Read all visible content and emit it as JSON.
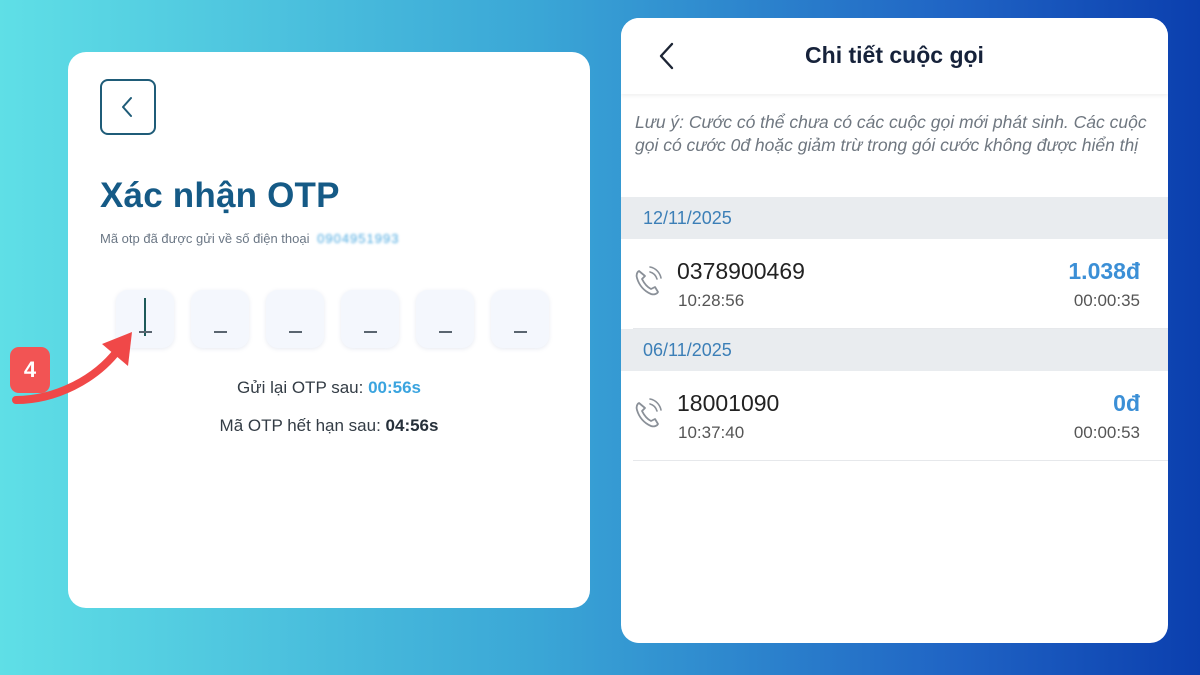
{
  "otp": {
    "title": "Xác nhận OTP",
    "subtitle": "Mã otp đã được gửi về số điện thoại",
    "phone_masked": "0904951993",
    "boxes": [
      "",
      "",
      "",
      "",
      "",
      ""
    ],
    "resend_label": "Gửi lại OTP sau: ",
    "resend_timer": "00:56s",
    "expire_label": "Mã OTP hết hạn sau: ",
    "expire_timer": "04:56s",
    "step_badge": "4"
  },
  "call_detail": {
    "title": "Chi tiết cuộc gọi",
    "note": "Lưu ý: Cước có thể chưa có các cuộc gọi mới phát sinh. Các cuộc gọi có cước 0đ hoặc giảm trừ trong gói cước không được hiển thị",
    "groups": [
      {
        "date": "12/11/2025",
        "calls": [
          {
            "number": "0378900469",
            "time": "10:28:56",
            "cost": "1.038đ",
            "duration": "00:00:35"
          }
        ]
      },
      {
        "date": "06/11/2025",
        "calls": [
          {
            "number": "18001090",
            "time": "10:37:40",
            "cost": "0đ",
            "duration": "00:00:53"
          }
        ]
      }
    ]
  },
  "colors": {
    "title_blue": "#155a86",
    "timer_blue": "#3aa4df",
    "cost_blue": "#3b8fd6",
    "badge_red": "#f25454"
  },
  "icons": [
    "chevron-left-icon",
    "phone-call-icon",
    "arrow-icon"
  ]
}
